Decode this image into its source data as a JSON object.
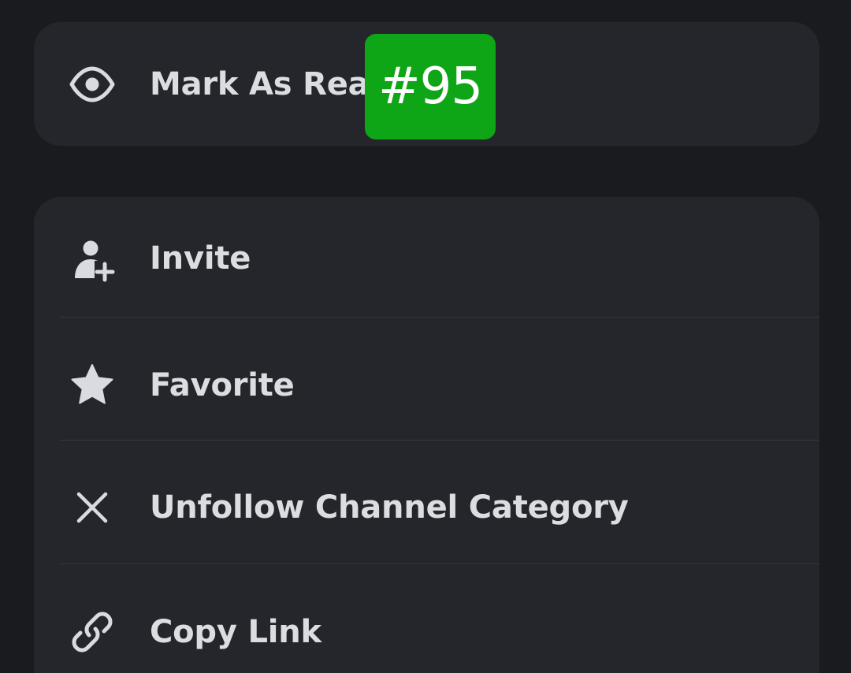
{
  "top_menu": {
    "mark_as_read": {
      "label": "Mark As Read",
      "icon": "eye-icon"
    }
  },
  "main_menu": {
    "items": [
      {
        "label": "Invite",
        "icon": "add-user-icon"
      },
      {
        "label": "Favorite",
        "icon": "star-icon"
      },
      {
        "label": "Unfollow Channel Category",
        "icon": "close-icon"
      },
      {
        "label": "Copy Link",
        "icon": "link-icon"
      }
    ]
  },
  "overlay_badge": {
    "text": "#95",
    "color": "#0ea516"
  },
  "colors": {
    "background": "#1a1b1e",
    "card": "#25262c",
    "text": "#dbdee1",
    "divider": "#343640"
  }
}
